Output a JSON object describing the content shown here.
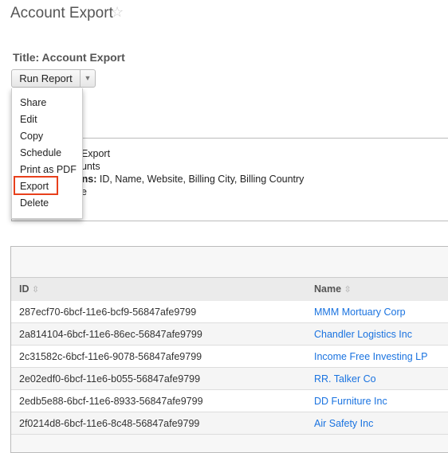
{
  "header": {
    "title": "Account Export",
    "favorite_icon": "star-icon"
  },
  "report_title": "Title: Account Export",
  "run_button": {
    "label": "Run Report",
    "caret_icon": "caret-down-icon"
  },
  "menu": {
    "items": [
      "Share",
      "Edit",
      "Copy",
      "Schedule",
      "Print as PDF",
      "Export",
      "Delete"
    ],
    "highlighted": "Export",
    "highlight_color": "#e8401c"
  },
  "details": {
    "lines": [
      {
        "label": "",
        "value": "t Export"
      },
      {
        "label": "",
        "value": "ounts"
      },
      {
        "label": "nns:",
        "value": " ID, Name, Website, Billing City, Billing Country"
      },
      {
        "label": "",
        "value": "ne"
      }
    ]
  },
  "table": {
    "columns": [
      "ID",
      "Name"
    ],
    "rows": [
      [
        "287ecf70-6bcf-11e6-bcf9-56847afe9799",
        "MMM Mortuary Corp"
      ],
      [
        "2a814104-6bcf-11e6-86ec-56847afe9799",
        "Chandler Logistics Inc"
      ],
      [
        "2c31582c-6bcf-11e6-9078-56847afe9799",
        "Income Free Investing LP"
      ],
      [
        "2e02edf0-6bcf-11e6-b055-56847afe9799",
        "RR. Talker Co"
      ],
      [
        "2edb5e88-6bcf-11e6-8933-56847afe9799",
        "DD Furniture Inc"
      ],
      [
        "2f0214d8-6bcf-11e6-8c48-56847afe9799",
        "Air Safety Inc"
      ]
    ],
    "link_color": "#1a73e0"
  }
}
